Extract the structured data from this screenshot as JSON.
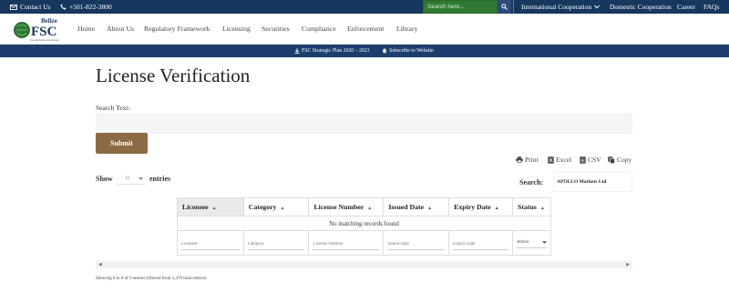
{
  "topbar": {
    "contact": "Contact Us",
    "phone": "+501-822-3800",
    "search_placeholder": "Search here...",
    "links": [
      "International Cooperation",
      "Domestic Cooperation",
      "Career",
      "FAQs"
    ]
  },
  "logo": {
    "line1": "Belize",
    "line2": "FSC",
    "tagline": "Financial Services Commission"
  },
  "nav": {
    "items": [
      "Home",
      "About Us",
      "Regulatory Framework",
      "Licensing",
      "Securities",
      "Compliance",
      "Enforcement",
      "Library"
    ]
  },
  "subbar": {
    "strategic_plan": "FSC Strategic Plan 2020 – 2023",
    "subscribe": "Subscribe to Website"
  },
  "page": {
    "title": "License Verification",
    "search_label": "Search Text:",
    "submit_label": "Submit"
  },
  "export": {
    "print": "Print",
    "excel": "Excel",
    "csv": "CSV",
    "copy": "Copy"
  },
  "table_controls": {
    "show_label": "Show",
    "page_length": "10",
    "entries_label": "entries",
    "search_label": "Search:",
    "search_value": "APOLLO Markets Ltd"
  },
  "table": {
    "columns": [
      "Licensee",
      "Category",
      "License Number",
      "Issued Date",
      "Expiry Date",
      "Status"
    ],
    "empty_message": "No matching records found",
    "filter_placeholders": [
      "Licensee",
      "Category",
      "License Number",
      "Issued Date",
      "Expiry Date"
    ],
    "status_filter": "Active"
  },
  "info": "Showing 0 to 0 of 0 entries (filtered from 1,470 total entries)",
  "colors": {
    "topbar": "#17375e",
    "subbar": "#1c3d6e",
    "search_box": "#2f7a33",
    "submit": "#8b6a44"
  }
}
